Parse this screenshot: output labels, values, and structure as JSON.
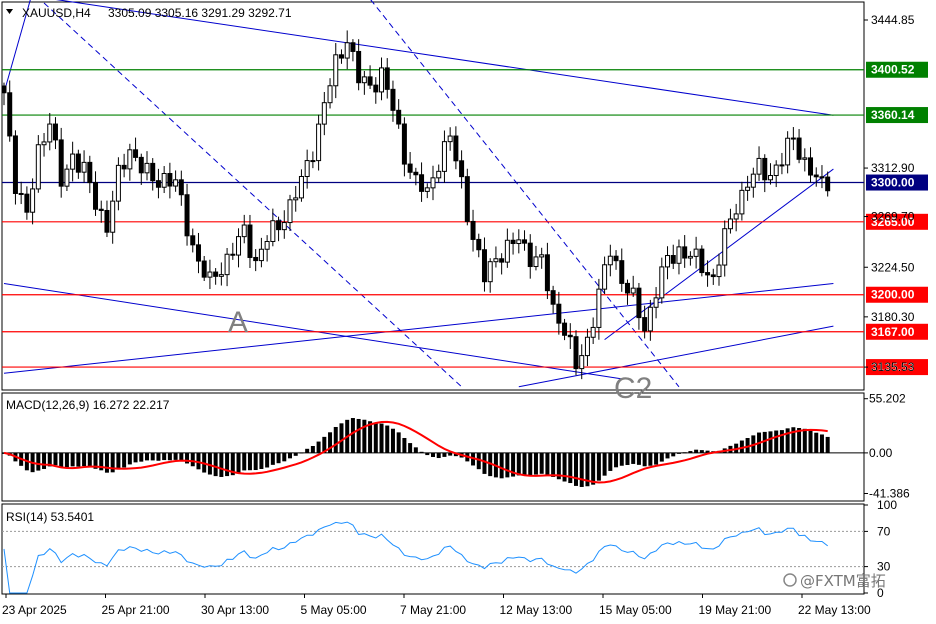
{
  "header": {
    "symbol": "XAUUSD,H4",
    "ohlc": "3305.09 3305.16 3291.29 3292.71",
    "menu_icon": "triangle-down-icon"
  },
  "price_axis": {
    "ticks": [
      "3444.85",
      "3312.90",
      "3269.70",
      "3224.50",
      "3180.30",
      "3135.53"
    ],
    "ylim": [
      3116,
      3460
    ]
  },
  "levels": [
    {
      "label": "3400.52",
      "value": 3400.52,
      "color": "#008000"
    },
    {
      "label": "3360.14",
      "value": 3360.14,
      "color": "#008000"
    },
    {
      "label": "3300.00",
      "value": 3300.0,
      "color": "#000080"
    },
    {
      "label": "3265.00",
      "value": 3265.0,
      "color": "#ff0000"
    },
    {
      "label": "3200.00",
      "value": 3200.0,
      "color": "#ff0000"
    },
    {
      "label": "3167.00",
      "value": 3167.0,
      "color": "#ff0000"
    },
    {
      "label": "3135.53",
      "value": 3135.53,
      "color": "#ff0000"
    }
  ],
  "wave_labels": [
    "A",
    "C2"
  ],
  "macd": {
    "label": "MACD(12,26,9) 16.272 22.217",
    "ticks": [
      "55.202",
      "0.00",
      "-41.386"
    ],
    "ylim": [
      -48,
      60
    ]
  },
  "rsi": {
    "label": "RSI(14) 53.5401",
    "ticks": [
      "100",
      "70",
      "30",
      "0"
    ],
    "ylim": [
      0,
      100
    ]
  },
  "time_axis": {
    "labels": [
      "23 Apr 2025",
      "25 Apr 21:00",
      "30 Apr 13:00",
      "5 May 05:00",
      "7 May 21:00",
      "12 May 13:00",
      "15 May 05:00",
      "19 May 21:00",
      "22 May 13:00"
    ]
  },
  "watermark": {
    "handle": "@FXTM富拓",
    "icon": "chat-bubble-icon"
  },
  "colors": {
    "bull_body": "#ffffff",
    "bear_body": "#000000",
    "candle_outline": "#000000",
    "trendline": "#0000cd",
    "macd_signal": "#ff0000",
    "rsi_line": "#1e90ff",
    "support": "#ff0000",
    "resistance": "#008000"
  },
  "chart_data": {
    "type": "candlestick",
    "symbol": "XAUUSD",
    "timeframe": "H4",
    "x_labels": [
      "23 Apr 2025",
      "25 Apr 21:00",
      "30 Apr 13:00",
      "5 May 05:00",
      "7 May 21:00",
      "12 May 13:00",
      "15 May 05:00",
      "19 May 21:00",
      "22 May 13:00"
    ],
    "close_path": [
      [
        0,
        3380
      ],
      [
        2,
        3300
      ],
      [
        4,
        3268
      ],
      [
        6,
        3330
      ],
      [
        8,
        3355
      ],
      [
        10,
        3300
      ],
      [
        12,
        3325
      ],
      [
        14,
        3310
      ],
      [
        16,
        3282
      ],
      [
        18,
        3262
      ],
      [
        20,
        3305
      ],
      [
        22,
        3330
      ],
      [
        24,
        3315
      ],
      [
        26,
        3300
      ],
      [
        28,
        3305
      ],
      [
        30,
        3300
      ],
      [
        32,
        3260
      ],
      [
        34,
        3230
      ],
      [
        36,
        3210
      ],
      [
        38,
        3225
      ],
      [
        40,
        3240
      ],
      [
        42,
        3255
      ],
      [
        44,
        3230
      ],
      [
        46,
        3250
      ],
      [
        48,
        3262
      ],
      [
        50,
        3280
      ],
      [
        52,
        3300
      ],
      [
        54,
        3330
      ],
      [
        56,
        3370
      ],
      [
        58,
        3405
      ],
      [
        60,
        3430
      ],
      [
        62,
        3392
      ],
      [
        64,
        3385
      ],
      [
        66,
        3398
      ],
      [
        68,
        3365
      ],
      [
        70,
        3325
      ],
      [
        72,
        3300
      ],
      [
        74,
        3290
      ],
      [
        76,
        3320
      ],
      [
        78,
        3340
      ],
      [
        80,
        3300
      ],
      [
        82,
        3250
      ],
      [
        84,
        3215
      ],
      [
        86,
        3235
      ],
      [
        88,
        3240
      ],
      [
        90,
        3250
      ],
      [
        92,
        3235
      ],
      [
        94,
        3228
      ],
      [
        96,
        3188
      ],
      [
        98,
        3170
      ],
      [
        100,
        3135
      ],
      [
        102,
        3160
      ],
      [
        104,
        3200
      ],
      [
        106,
        3240
      ],
      [
        108,
        3215
      ],
      [
        110,
        3195
      ],
      [
        112,
        3170
      ],
      [
        114,
        3205
      ],
      [
        116,
        3230
      ],
      [
        118,
        3240
      ],
      [
        120,
        3235
      ],
      [
        122,
        3225
      ],
      [
        124,
        3215
      ],
      [
        126,
        3250
      ],
      [
        128,
        3280
      ],
      [
        130,
        3300
      ],
      [
        132,
        3312
      ],
      [
        134,
        3308
      ],
      [
        136,
        3320
      ],
      [
        138,
        3340
      ],
      [
        140,
        3318
      ],
      [
        142,
        3302
      ],
      [
        144,
        3292.71
      ]
    ],
    "levels": [
      3400.52,
      3360.14,
      3300.0,
      3265.0,
      3200.0,
      3167.0,
      3135.53
    ],
    "indicators": {
      "macd": {
        "params": "12,26,9",
        "value": 16.272,
        "signal": 22.217
      },
      "rsi": {
        "period": 14,
        "value": 53.5401
      }
    }
  }
}
